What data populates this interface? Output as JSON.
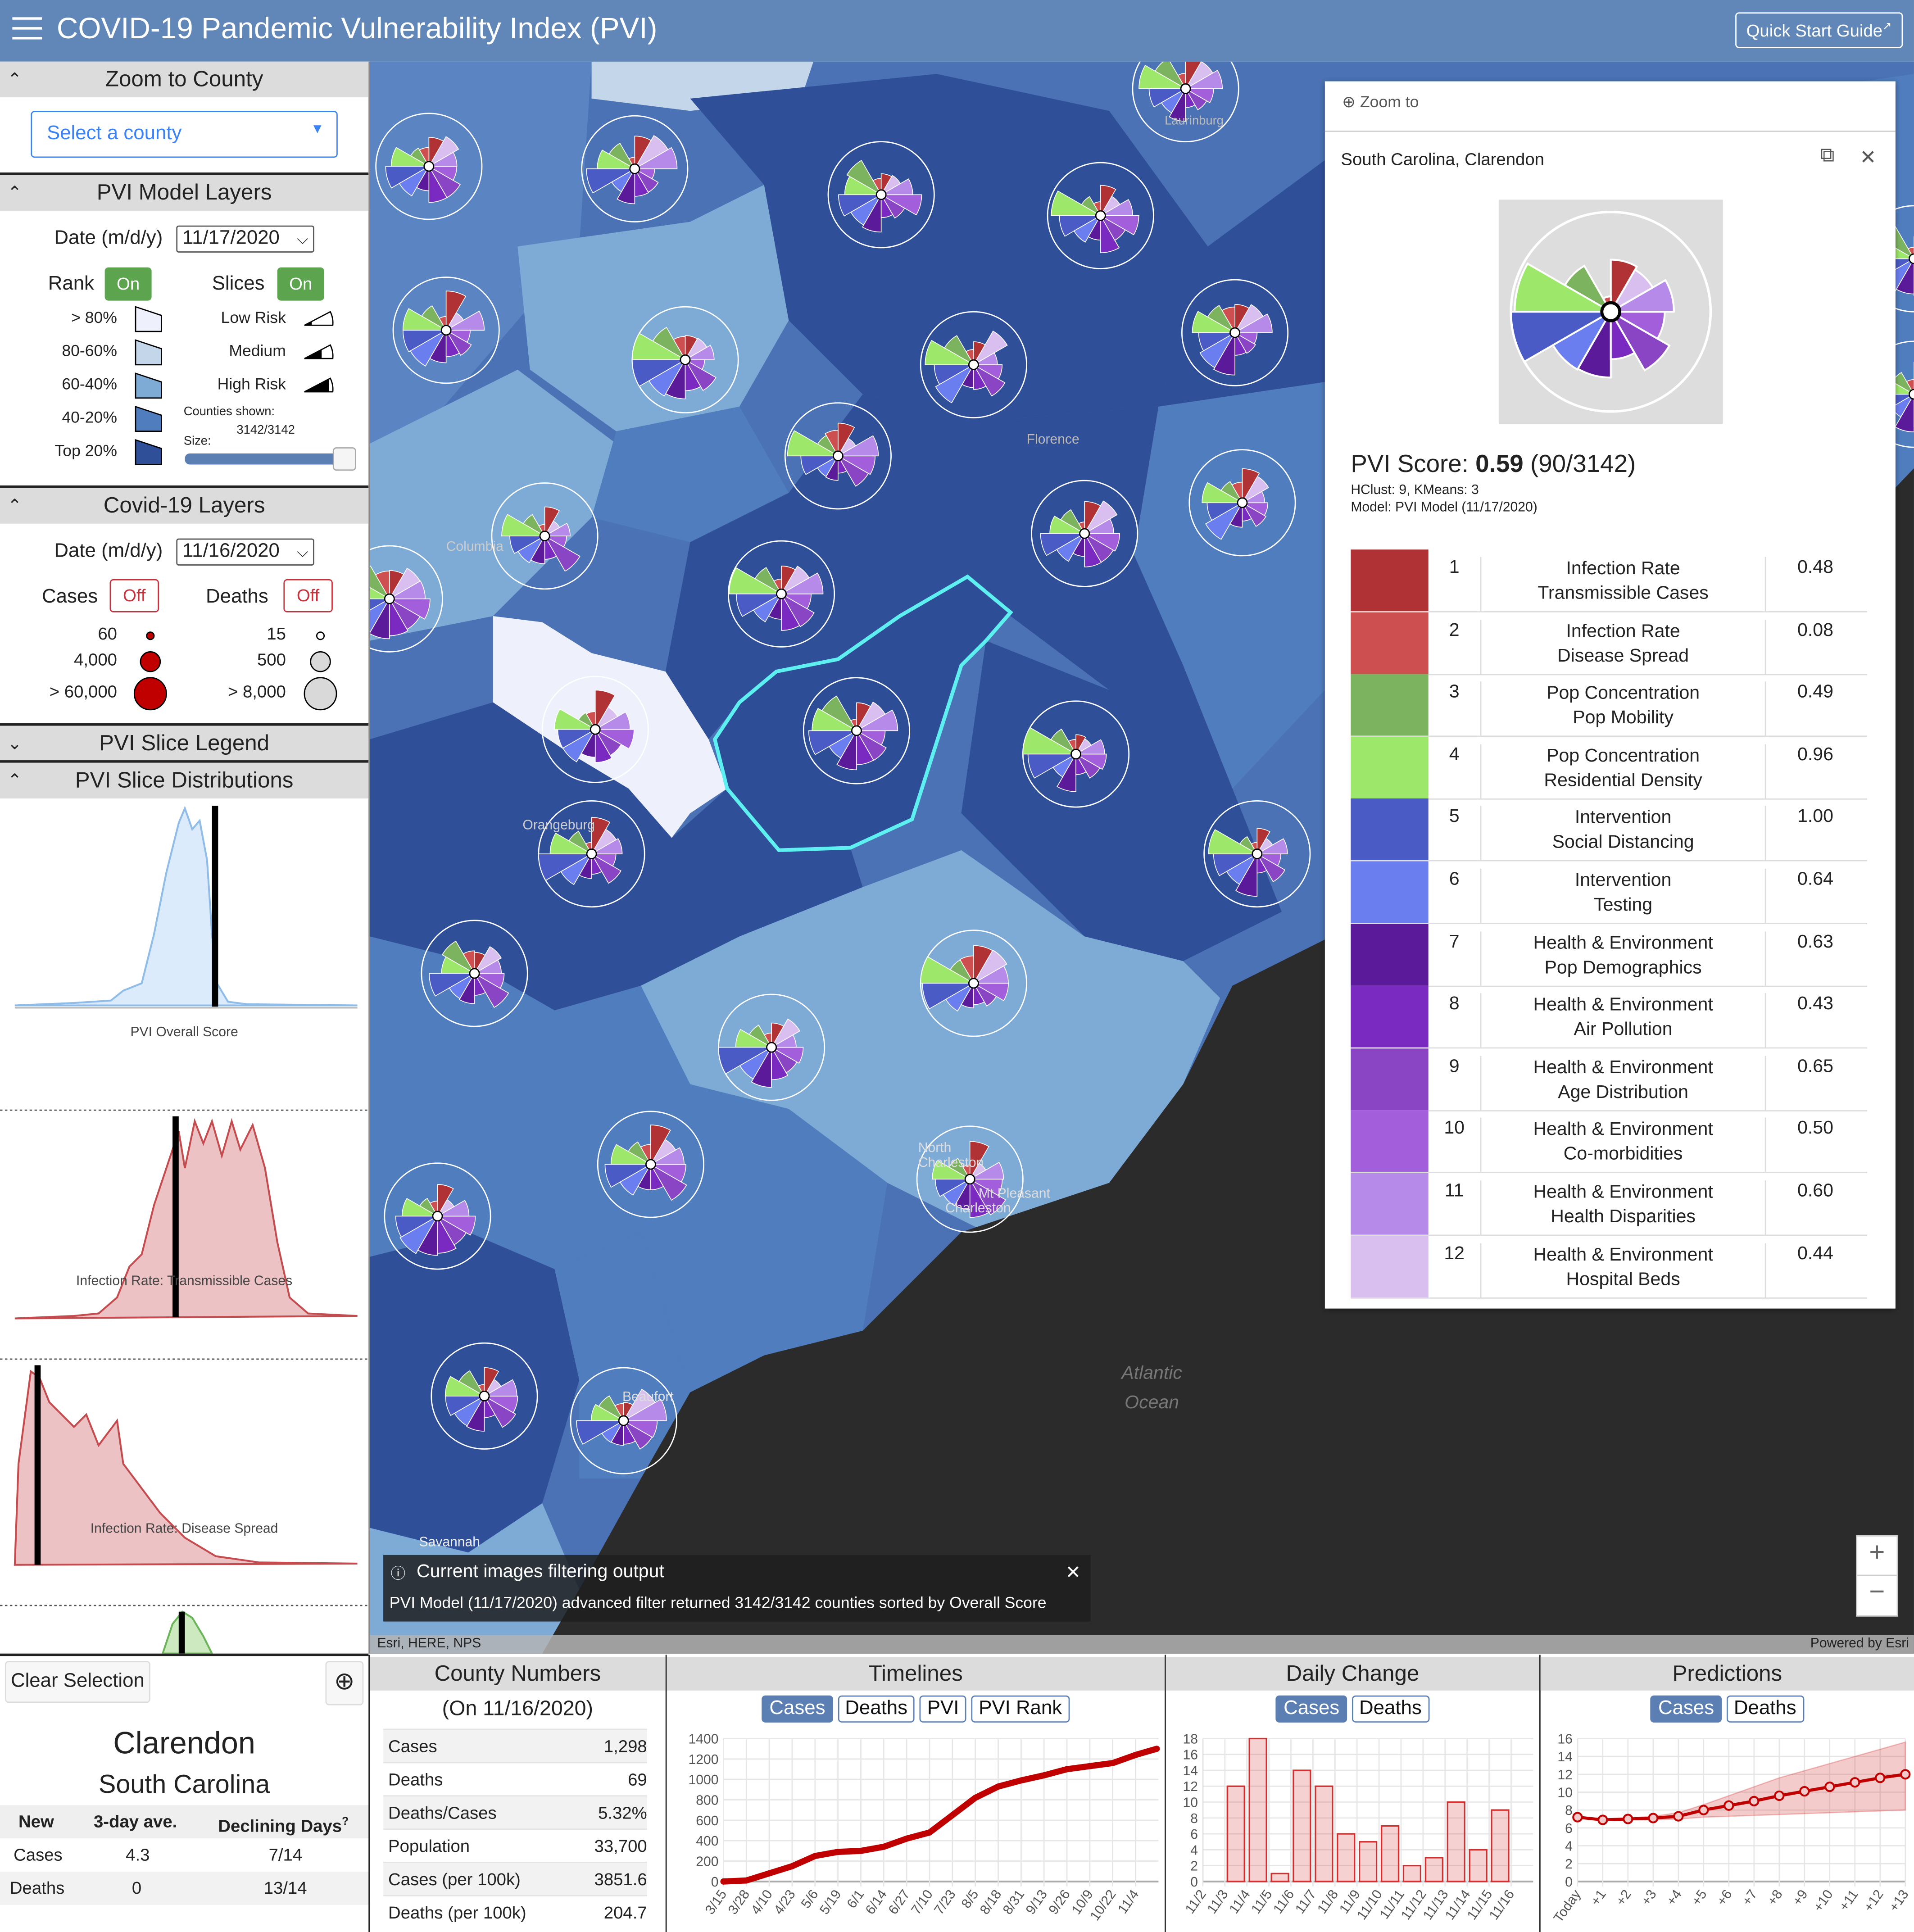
{
  "header": {
    "title": "COVID-19 Pandemic Vulnerability Index (PVI)",
    "quick_start": "Quick Start Guide",
    "colors": {
      "header": "#6187b8"
    }
  },
  "sidebar": {
    "zoom_section": {
      "title": "Zoom to County",
      "select_placeholder": "Select a county"
    },
    "pvi_section": {
      "title": "PVI Model Layers",
      "date_label": "Date (m/d/y)",
      "date_value": "11/17/2020",
      "rank_label": "Rank",
      "rank_toggle": "On",
      "slices_label": "Slices",
      "slices_toggle": "On",
      "rank_legend": [
        {
          "label": "> 80%",
          "color": "#eef0fb"
        },
        {
          "label": "80-60%",
          "color": "#c4d6ea"
        },
        {
          "label": "60-40%",
          "color": "#7eaad6"
        },
        {
          "label": "40-20%",
          "color": "#4f7dbd"
        },
        {
          "label": "Top 20%",
          "color": "#2f4f99"
        }
      ],
      "slice_legend": [
        "Low Risk",
        "Medium",
        "High Risk"
      ],
      "counties_shown_label": "Counties shown:",
      "counties_shown_value": "3142/3142",
      "size_label": "Size:",
      "size_slider_value": 0.95
    },
    "covid_section": {
      "title": "Covid-19 Layers",
      "date_label": "Date (m/d/y)",
      "date_value": "11/16/2020",
      "cases_label": "Cases",
      "cases_toggle": "Off",
      "deaths_label": "Deaths",
      "deaths_toggle": "Off",
      "cases_legend": [
        "60",
        "4,000",
        "> 60,000"
      ],
      "deaths_legend": [
        "15",
        "500",
        "> 8,000"
      ],
      "cases_color": "#c00000",
      "deaths_color": "#d9d9d9"
    },
    "slice_legend_section": {
      "title": "PVI Slice Legend"
    },
    "distributions_section": {
      "title": "PVI Slice Distributions",
      "charts": [
        "PVI Overall Score",
        "Infection Rate: Transmissible Cases",
        "Infection Rate: Disease Spread"
      ]
    }
  },
  "map": {
    "labels": [
      "Laurinburg",
      "Florence",
      "Columbia",
      "Orangeburg",
      "North Charleston",
      "Mt Pleasant",
      "Charleston",
      "Beaufort",
      "Savannah"
    ],
    "ocean_label": [
      "Atlantic",
      "Ocean"
    ],
    "attribution": "Esri, HERE, NPS",
    "powered_by": "Powered by Esri",
    "notice": {
      "title": "Current images filtering output",
      "text": "PVI Model (11/17/2020) advanced filter returned 3142/3142 counties sorted by Overall Score"
    },
    "zoom_in": "+",
    "zoom_out": "−"
  },
  "popup": {
    "zoom_to": "Zoom to",
    "title": "South Carolina, Clarendon",
    "score_label": "PVI Score:",
    "score_value": "0.59",
    "score_rank": "(90/3142)",
    "clusters": "HClust: 9, KMeans: 3",
    "model": "Model: PVI Model (11/17/2020)",
    "slices": [
      {
        "rank": "1",
        "line1": "Infection Rate",
        "line2": "Transmissible Cases",
        "value": "0.48",
        "color": "#b03234"
      },
      {
        "rank": "2",
        "line1": "Infection Rate",
        "line2": "Disease Spread",
        "value": "0.08",
        "color": "#cd4f4f"
      },
      {
        "rank": "3",
        "line1": "Pop Concentration",
        "line2": "Pop Mobility",
        "value": "0.49",
        "color": "#7bb35f"
      },
      {
        "rank": "4",
        "line1": "Pop Concentration",
        "line2": "Residential Density",
        "value": "0.96",
        "color": "#9de86a"
      },
      {
        "rank": "5",
        "line1": "Intervention",
        "line2": "Social Distancing",
        "value": "1.00",
        "color": "#4a5bc6"
      },
      {
        "rank": "6",
        "line1": "Intervention",
        "line2": "Testing",
        "value": "0.64",
        "color": "#6a7ef0"
      },
      {
        "rank": "7",
        "line1": "Health & Environment",
        "line2": "Pop Demographics",
        "value": "0.63",
        "color": "#5a1a9a"
      },
      {
        "rank": "8",
        "line1": "Health & Environment",
        "line2": "Air Pollution",
        "value": "0.43",
        "color": "#7a2ac0"
      },
      {
        "rank": "9",
        "line1": "Health & Environment",
        "line2": "Age Distribution",
        "value": "0.65",
        "color": "#8a45c4"
      },
      {
        "rank": "10",
        "line1": "Health & Environment",
        "line2": "Co-morbidities",
        "value": "0.50",
        "color": "#a35edc"
      },
      {
        "rank": "11",
        "line1": "Health & Environment",
        "line2": "Health Disparities",
        "value": "0.60",
        "color": "#b68ae8"
      },
      {
        "rank": "12",
        "line1": "Health & Environment",
        "line2": "Hospital Beds",
        "value": "0.44",
        "color": "#d8bff0"
      }
    ]
  },
  "county": {
    "clear_selection": "Clear Selection",
    "name": "Clarendon",
    "state": "South Carolina",
    "table": {
      "headers": [
        "New",
        "3-day ave.",
        "Declining Days"
      ],
      "help_mark": "?",
      "rows": [
        [
          "Cases",
          "4.3",
          "7/14"
        ],
        [
          "Deaths",
          "0",
          "13/14"
        ]
      ]
    }
  },
  "county_numbers": {
    "title": "County Numbers",
    "subtitle": "(On 11/16/2020)",
    "rows": [
      [
        "Cases",
        "1,298"
      ],
      [
        "Deaths",
        "69"
      ],
      [
        "Deaths/Cases",
        "5.32%"
      ],
      [
        "Population",
        "33,700"
      ],
      [
        "Cases (per 100k)",
        "3851.6"
      ],
      [
        "Deaths (per 100k)",
        "204.7"
      ]
    ]
  },
  "timelines": {
    "title": "Timelines",
    "buttons": [
      "Cases",
      "Deaths",
      "PVI",
      "PVI Rank"
    ],
    "active": "Cases"
  },
  "daily": {
    "title": "Daily Change",
    "buttons": [
      "Cases",
      "Deaths"
    ],
    "active": "Cases"
  },
  "predictions": {
    "title": "Predictions",
    "buttons": [
      "Cases",
      "Deaths"
    ],
    "active": "Cases"
  },
  "chart_data": [
    {
      "type": "line",
      "panel": "Timelines",
      "ylim": [
        0,
        1400
      ],
      "yticks": [
        0,
        200,
        400,
        600,
        800,
        1000,
        1200,
        1400
      ],
      "xticks": [
        "3/15",
        "3/28",
        "4/10",
        "4/23",
        "5/6",
        "5/19",
        "6/1",
        "6/14",
        "6/27",
        "7/10",
        "7/23",
        "8/5",
        "8/18",
        "8/31",
        "9/13",
        "9/26",
        "10/9",
        "10/22",
        "11/4"
      ],
      "x": [
        "3/15",
        "3/28",
        "4/10",
        "4/23",
        "5/6",
        "5/19",
        "6/1",
        "6/14",
        "6/27",
        "7/10",
        "7/23",
        "8/5",
        "8/18",
        "8/31",
        "9/13",
        "9/26",
        "10/9",
        "10/22",
        "11/4",
        "11/16"
      ],
      "values": [
        0,
        10,
        80,
        150,
        250,
        290,
        300,
        340,
        420,
        480,
        650,
        820,
        930,
        990,
        1040,
        1100,
        1130,
        1160,
        1240,
        1300
      ],
      "color": "#c00000",
      "grid": true
    },
    {
      "type": "bar",
      "panel": "Daily Change",
      "ylim": [
        0,
        18
      ],
      "yticks": [
        0,
        2,
        4,
        6,
        8,
        10,
        12,
        14,
        16,
        18
      ],
      "categories": [
        "11/2",
        "11/3",
        "11/4",
        "11/5",
        "11/6",
        "11/7",
        "11/8",
        "11/9",
        "11/10",
        "11/11",
        "11/12",
        "11/13",
        "11/14",
        "11/15",
        "11/16"
      ],
      "values": [
        0,
        12,
        18,
        1,
        14,
        12,
        6,
        5,
        7,
        2,
        3,
        10,
        4,
        9,
        0
      ],
      "color": "#d32f2f",
      "grid": true
    },
    {
      "type": "line",
      "panel": "Predictions",
      "ylim": [
        0,
        16
      ],
      "yticks": [
        0,
        2,
        4,
        6,
        8,
        10,
        12,
        14,
        16
      ],
      "categories": [
        "Today",
        "+1",
        "+2",
        "+3",
        "+4",
        "+5",
        "+6",
        "+7",
        "+8",
        "+9",
        "+10",
        "+11",
        "+12",
        "+13"
      ],
      "values": [
        7.2,
        6.9,
        7.0,
        7.1,
        7.3,
        8.0,
        8.5,
        9.0,
        9.6,
        10.1,
        10.6,
        11.1,
        11.6,
        12.0
      ],
      "lower": [
        7.2,
        6.8,
        6.9,
        6.9,
        7.0,
        7.2,
        7.3,
        7.4,
        7.5,
        7.6,
        7.7,
        7.8,
        7.9,
        8.0
      ],
      "upper": [
        7.2,
        7.0,
        7.1,
        7.3,
        7.7,
        8.6,
        9.6,
        10.6,
        11.6,
        12.4,
        13.2,
        14.0,
        14.8,
        15.6
      ],
      "color": "#c00000",
      "grid": true
    }
  ]
}
